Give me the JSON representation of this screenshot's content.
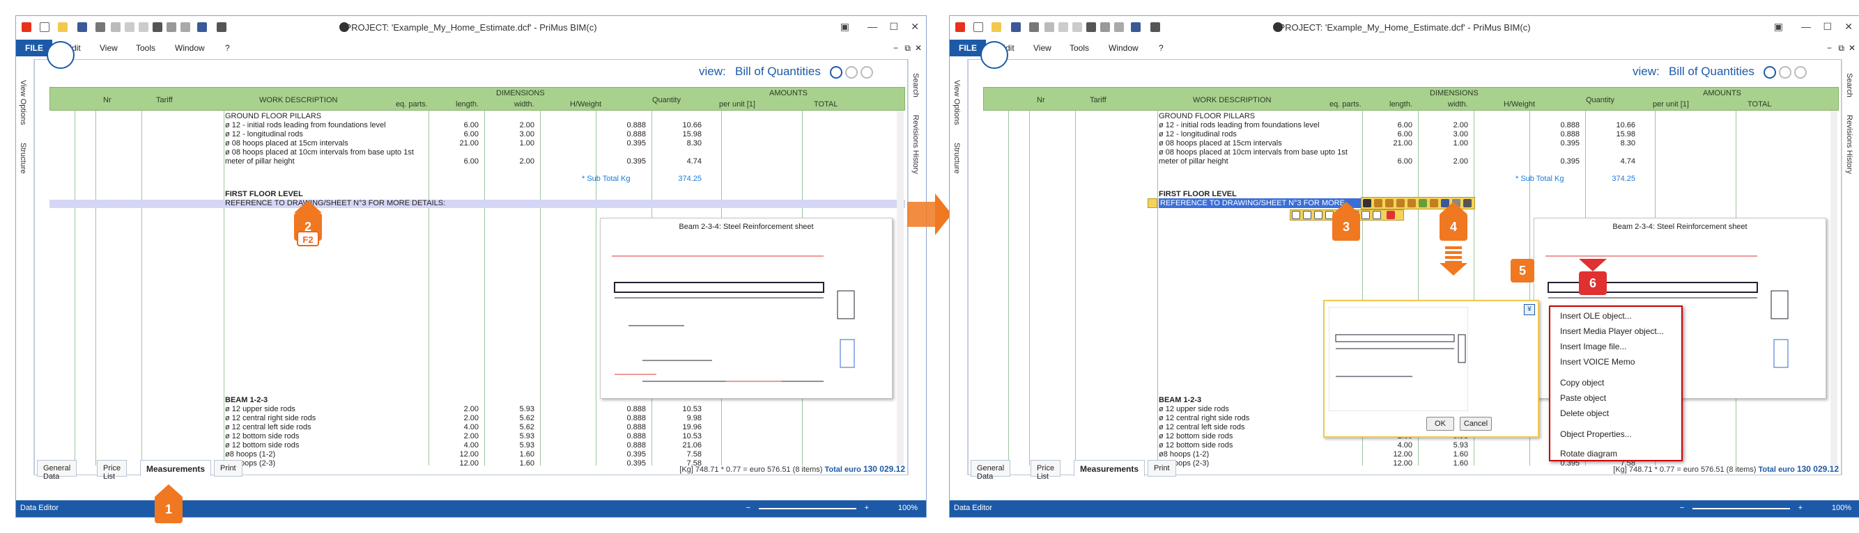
{
  "app": {
    "title": "PROJECT: 'Example_My_Home_Estimate.dcf' - PriMus   BIM(c)",
    "file_label": "FILE",
    "menu": [
      "Edit",
      "View",
      "Tools",
      "Window",
      "?"
    ],
    "view_prefix": "view:",
    "view_name": "Bill of Quantities",
    "left_tabs": [
      "View Options",
      "Structure"
    ],
    "right_tabs": [
      "Search",
      "Revisions History"
    ]
  },
  "header": {
    "nr": "Nr",
    "tariff": "Tariff",
    "work": "WORK DESCRIPTION",
    "dimensions": "DIMENSIONS",
    "eq_parts": "eq. parts.",
    "length": "length.",
    "width": "width.",
    "hweight": "H/Weight",
    "quantity": "Quantity",
    "amounts": "AMOUNTS",
    "per_unit": "per unit [1]",
    "total": "TOTAL"
  },
  "rows": [
    {
      "desc": "GROUND FLOOR PILLARS",
      "eq": "",
      "len": "",
      "hw": "",
      "qty": ""
    },
    {
      "desc": "ø 12 - initial rods leading from foundations level",
      "eq": "6.00",
      "len": "2.00",
      "hw": "0.888",
      "qty": "10.66"
    },
    {
      "desc": "ø 12 - longitudinal rods",
      "eq": "6.00",
      "len": "3.00",
      "hw": "0.888",
      "qty": "15.98"
    },
    {
      "desc": "ø 08 hoops placed at 15cm intervals",
      "eq": "21.00",
      "len": "1.00",
      "hw": "0.395",
      "qty": "8.30"
    },
    {
      "desc": "ø 08 hoops placed at 10cm intervals from base upto 1st",
      "eq": "",
      "len": "",
      "hw": "",
      "qty": ""
    },
    {
      "desc": "meter of pillar height",
      "eq": "6.00",
      "len": "2.00",
      "hw": "0.395",
      "qty": "4.74"
    }
  ],
  "subtotal_label": "* Sub Total Kg",
  "subtotal_value": "374.25",
  "first_floor": "FIRST FLOOR LEVEL",
  "reference_line": "REFERENCE TO DRAWING/SHEET N°3 FOR MORE DETAILS:",
  "beam_rows": [
    {
      "desc": "BEAM 1-2-3",
      "eq": "",
      "len": "",
      "hw": "",
      "qty": ""
    },
    {
      "desc": "ø 12 upper side rods",
      "eq": "2.00",
      "len": "5.93",
      "hw": "0.888",
      "qty": "10.53"
    },
    {
      "desc": "ø 12 central right side rods",
      "eq": "2.00",
      "len": "5.62",
      "hw": "0.888",
      "qty": "9.98"
    },
    {
      "desc": "ø 12 central left side rods",
      "eq": "4.00",
      "len": "5.62",
      "hw": "0.888",
      "qty": "19.96"
    },
    {
      "desc": "ø 12 bottom side rods",
      "eq": "2.00",
      "len": "5.93",
      "hw": "0.888",
      "qty": "10.53"
    },
    {
      "desc": "ø 12 bottom side rods",
      "eq": "4.00",
      "len": "5.93",
      "hw": "0.888",
      "qty": "21.06"
    },
    {
      "desc": "ø8 hoops (1-2)",
      "eq": "12.00",
      "len": "1.60",
      "hw": "0.395",
      "qty": "7.58"
    },
    {
      "desc": "ø8 hoops (2-3)",
      "eq": "12.00",
      "len": "1.60",
      "hw": "0.395",
      "qty": "7.58"
    }
  ],
  "drawing_title": "Beam 2-3-4: Steel Reinforcement sheet",
  "bottom_tabs": [
    "General Data",
    "Price List",
    "Measurements",
    "Print"
  ],
  "totals": {
    "calc": "[Kg] 748.71 * 0.77 = euro 576.51",
    "items": "(8 items)",
    "total_label": "Total",
    "currency": "euro",
    "amount": "130 029.12"
  },
  "status": {
    "mode": "Data Editor",
    "zoom": "100%",
    "minus": "−",
    "plus": "+"
  },
  "callouts": {
    "c1": "1",
    "c2": "2",
    "f2": "F2",
    "c3": "3",
    "c4": "4",
    "c5": "5",
    "c6": "6"
  },
  "dialog": {
    "ok": "OK",
    "cancel": "Cancel"
  },
  "context_menu": [
    "Insert OLE object...",
    "Insert Media Player object...",
    "Insert Image file...",
    "Insert VOICE Memo",
    "Copy object",
    "Paste object",
    "Delete object",
    "Object Properties...",
    "Rotate diagram"
  ]
}
